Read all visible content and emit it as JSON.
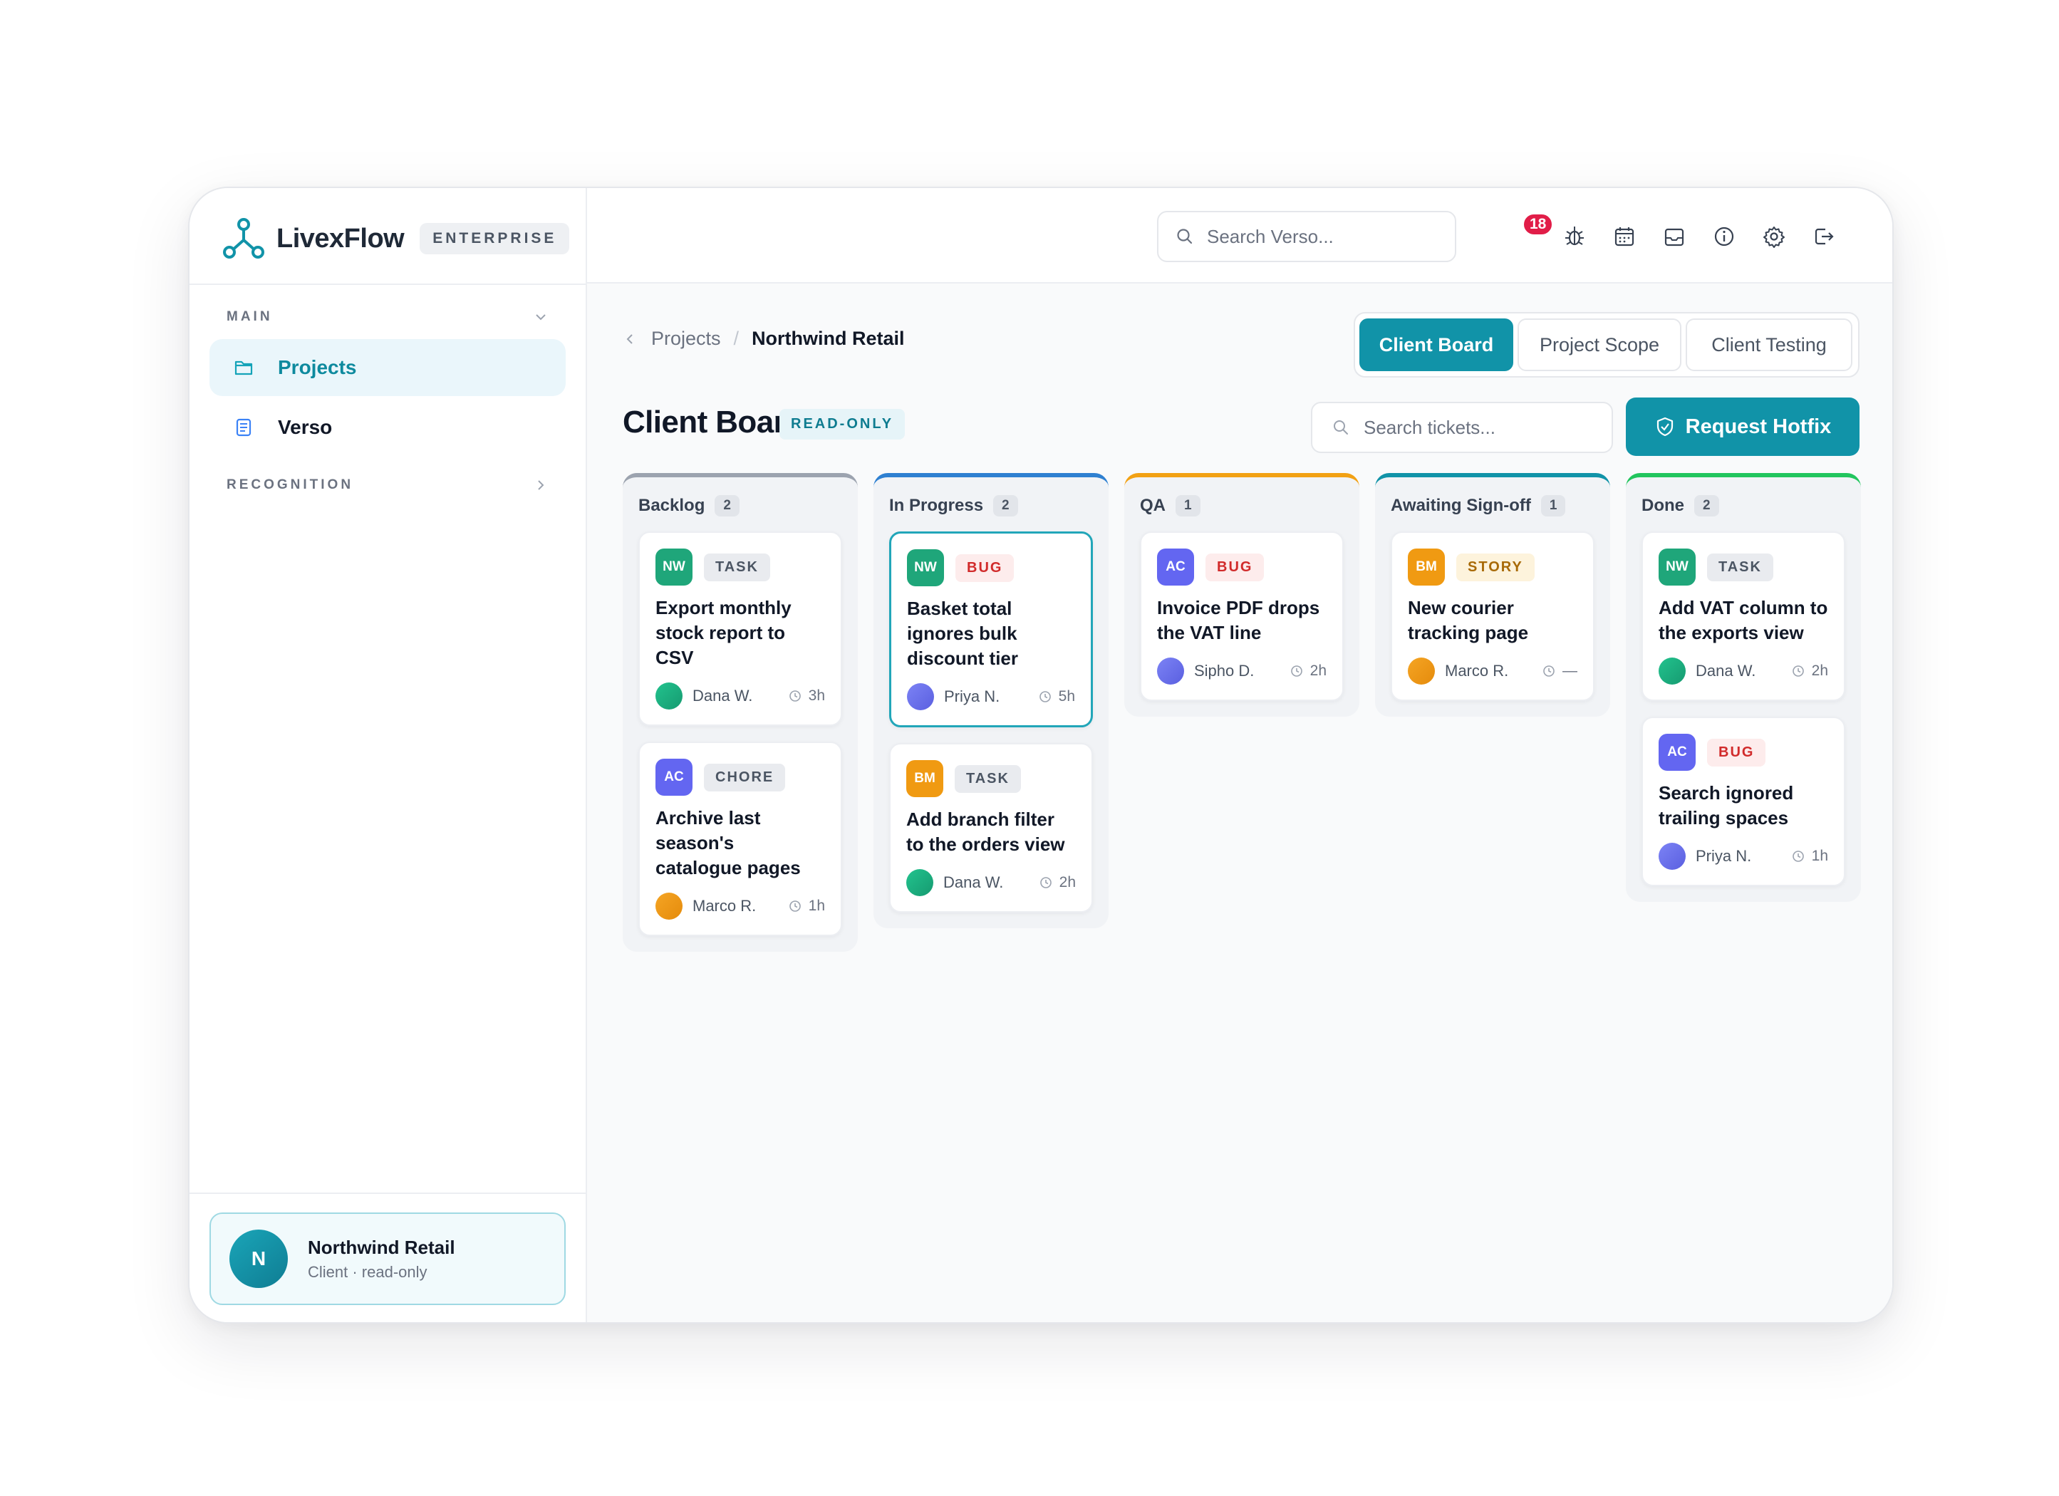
{
  "app": {
    "name": "LivexFlow",
    "edition": "ENTERPRISE"
  },
  "sidebar": {
    "sections": [
      {
        "label": "MAIN",
        "expanded": true
      },
      {
        "label": "RECOGNITION",
        "expanded": false
      }
    ],
    "items": [
      {
        "label": "Projects",
        "active": true,
        "icon": "folder-icon"
      },
      {
        "label": "Verso",
        "active": false,
        "icon": "document-icon"
      }
    ],
    "client": {
      "initial": "N",
      "name": "Northwind Retail",
      "role": "Client · read-only"
    }
  },
  "topbar": {
    "search_placeholder": "Search Verso...",
    "icons": [
      "bug-icon",
      "calendar-icon",
      "inbox-icon",
      "info-icon",
      "gear-icon",
      "logout-icon"
    ],
    "notification_count": "18"
  },
  "breadcrumb": {
    "parent": "Projects",
    "separator": "/",
    "current": "Northwind Retail"
  },
  "view_tabs": [
    {
      "label": "Client Board",
      "active": true
    },
    {
      "label": "Project Scope",
      "active": false
    },
    {
      "label": "Client Testing",
      "active": false
    }
  ],
  "board": {
    "title": "Client Board",
    "badge": "READ-ONLY",
    "search_placeholder": "Search tickets...",
    "hotfix_label": "Request Hotfix",
    "columns": [
      {
        "title": "Backlog",
        "count": "2",
        "accent": "#9ca3af",
        "tickets": [
          {
            "project": "NW",
            "type": "TASK",
            "title": "Export monthly stock report to CSV",
            "assignee": "Dana W.",
            "estimate": "3h"
          },
          {
            "project": "AC",
            "type": "CHORE",
            "title": "Archive last season's catalogue pages",
            "assignee": "Marco R.",
            "estimate": "1h"
          }
        ]
      },
      {
        "title": "In Progress",
        "count": "2",
        "accent": "#2f80d1",
        "tickets": [
          {
            "project": "NW",
            "type": "BUG",
            "title": "Basket total ignores bulk discount tier",
            "assignee": "Priya N.",
            "estimate": "5h",
            "selected": true
          },
          {
            "project": "BM",
            "type": "TASK",
            "title": "Add branch filter to the orders view",
            "assignee": "Dana W.",
            "estimate": "2h"
          }
        ]
      },
      {
        "title": "QA",
        "count": "1",
        "accent": "#f2a114",
        "tickets": [
          {
            "project": "AC",
            "type": "BUG",
            "title": "Invoice PDF drops the VAT line",
            "assignee": "Sipho D.",
            "estimate": "2h"
          }
        ]
      },
      {
        "title": "Awaiting Sign-off",
        "count": "1",
        "accent": "#1193a8",
        "tickets": [
          {
            "project": "BM",
            "type": "STORY",
            "title": "New courier tracking page",
            "assignee": "Marco R.",
            "estimate": "—"
          }
        ]
      },
      {
        "title": "Done",
        "count": "2",
        "accent": "#22c55e",
        "tickets": [
          {
            "project": "NW",
            "type": "TASK",
            "title": "Add VAT column to the exports view",
            "assignee": "Dana W.",
            "estimate": "2h"
          },
          {
            "project": "AC",
            "type": "BUG",
            "title": "Search ignored trailing spaces",
            "assignee": "Priya N.",
            "estimate": "1h"
          }
        ]
      }
    ]
  },
  "colors": {
    "accent": "#1193a8",
    "project_NW": "#1fa67a",
    "project_AC": "#6366f1",
    "project_BM": "#f09a12",
    "tag_TASK": "#e9ebef",
    "tag_CHORE": "#e9ebef",
    "tag_BUG": "#fdecec",
    "tag_STORY": "#fdf3dc"
  }
}
